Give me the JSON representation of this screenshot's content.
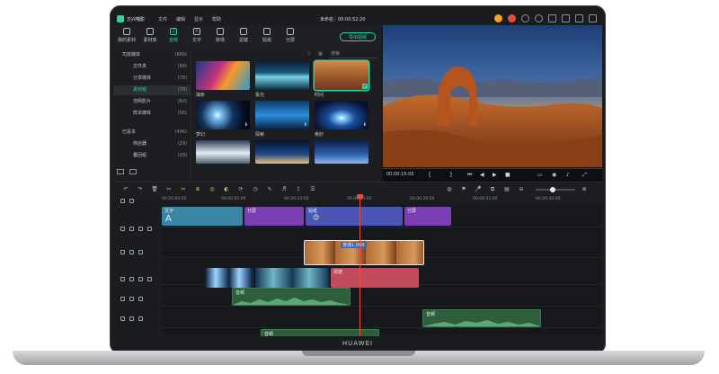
{
  "app": {
    "name": "万兴喵影",
    "menu": [
      "文件",
      "编辑",
      "显示",
      "帮助"
    ],
    "project_title": "未命名：00:00:52:20",
    "device_brand": "HUAWEI"
  },
  "toolbar_tabs": [
    {
      "label": "我的素材",
      "icon": "folder-icon"
    },
    {
      "label": "素材库",
      "icon": "library-icon"
    },
    {
      "label": "音频",
      "icon": "music-note-icon",
      "active": true
    },
    {
      "label": "文字",
      "icon": "text-icon"
    },
    {
      "label": "转场",
      "icon": "transition-icon"
    },
    {
      "label": "滤镜",
      "icon": "filter-icon"
    },
    {
      "label": "贴纸",
      "icon": "sticker-icon"
    },
    {
      "label": "分屏",
      "icon": "splitscreen-icon"
    }
  ],
  "export_label": "导出视频",
  "sidebar": {
    "groups": [
      {
        "label": "司技媒体",
        "count": "(889)",
        "items": [
          {
            "label": "文件夹",
            "count": "(88)"
          },
          {
            "label": "分享媒体",
            "count": "(78)"
          },
          {
            "label": "素材组",
            "count": "(78)",
            "active": true
          },
          {
            "label": "范例影片",
            "count": "(60)"
          },
          {
            "label": "样本媒体",
            "count": "(56)"
          }
        ]
      },
      {
        "label": "已投本",
        "count": "(496)",
        "items": [
          {
            "label": "商店器",
            "count": "(29)"
          },
          {
            "label": "叠回组",
            "count": "(29)"
          }
        ]
      }
    ]
  },
  "media_search_placeholder": "搜索",
  "media_items": [
    {
      "label": "抽象"
    },
    {
      "label": "极光"
    },
    {
      "label": "时间"
    },
    {
      "label": "梦幻"
    },
    {
      "label": "探索"
    },
    {
      "label": "奥妙"
    },
    {
      "label": ""
    },
    {
      "label": ""
    },
    {
      "label": ""
    }
  ],
  "preview": {
    "timecode": "00:00:15:00",
    "progress": 0.5
  },
  "ruler_ticks": [
    "00:00:00:00",
    "00:00:05:00",
    "00:00:10:00",
    "00:00:15:00",
    "00:00:20:00",
    "00:00:25:00",
    "00:00:30:00"
  ],
  "clips": {
    "text": "文字",
    "split1": "分屏",
    "sticker": "贴纸",
    "split2": "分屏",
    "speed": "普通1.00X",
    "filter": "滤镜",
    "audio1": "音频",
    "audio2": "音频",
    "audio3": "音频"
  },
  "colors": {
    "accent": "#2fd3a4",
    "text_clip": "#3b86a6",
    "split_clip": "#7b3fb3",
    "sticker_clip": "#4a55b5",
    "filter_clip": "#c24b5d",
    "audio_clip": "#2e5e3c",
    "playhead": "#e94e3c"
  }
}
